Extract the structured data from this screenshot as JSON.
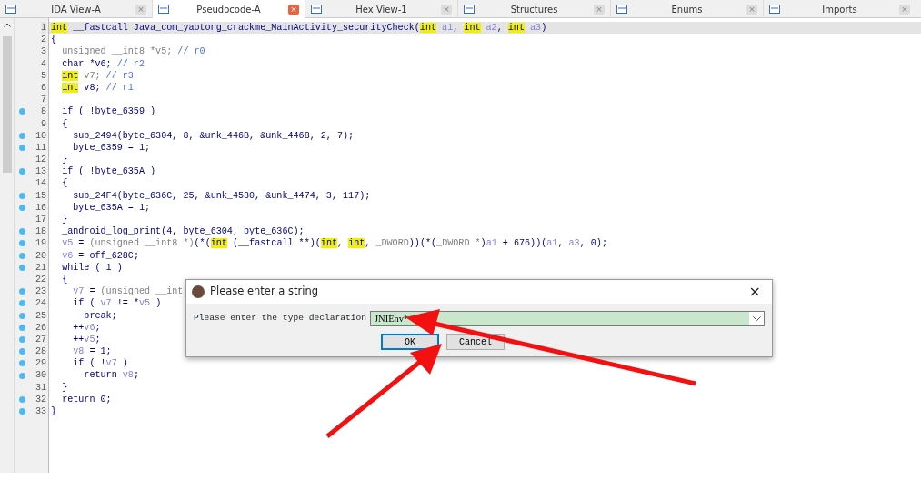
{
  "tabs": [
    {
      "label": "IDA View-A",
      "close": "×",
      "selected": false
    },
    {
      "label": "Pseudocode-A",
      "close": "×",
      "selected": true
    },
    {
      "label": "Hex View-1",
      "close": "×",
      "selected": false
    },
    {
      "label": "Structures",
      "close": "×",
      "selected": false
    },
    {
      "label": "Enums",
      "close": "×",
      "selected": false
    },
    {
      "label": "Imports",
      "close": "×",
      "selected": false
    }
  ],
  "code": [
    {
      "num": "1",
      "breakpoint": false,
      "current": true,
      "segments": [
        {
          "t": "int",
          "kind": "highlight"
        },
        {
          "t": " __fastcall Java_com_yaotong_crackme_MainActivity_securityCheck(",
          "kind": "normal"
        },
        {
          "t": "int",
          "kind": "highlight"
        },
        {
          "t": " a1",
          "kind": "variable"
        },
        {
          "t": ", ",
          "kind": "normal"
        },
        {
          "t": "int",
          "kind": "highlight"
        },
        {
          "t": " a2",
          "kind": "variable"
        },
        {
          "t": ", ",
          "kind": "normal"
        },
        {
          "t": "int",
          "kind": "highlight"
        },
        {
          "t": " a3",
          "kind": "variable"
        },
        {
          "t": ")",
          "kind": "normal"
        }
      ]
    },
    {
      "num": "2",
      "breakpoint": false,
      "current": false,
      "segments": [
        {
          "t": "{",
          "kind": "normal"
        }
      ]
    },
    {
      "num": "3",
      "breakpoint": false,
      "current": false,
      "segments": [
        {
          "t": "  unsigned __int8 *v5; ",
          "kind": "grey"
        },
        {
          "t": "// r0",
          "kind": "comment"
        }
      ]
    },
    {
      "num": "4",
      "breakpoint": false,
      "current": false,
      "segments": [
        {
          "t": "  char *v6; ",
          "kind": "normal"
        },
        {
          "t": "// r2",
          "kind": "comment"
        }
      ]
    },
    {
      "num": "5",
      "breakpoint": false,
      "current": false,
      "segments": [
        {
          "t": "  int",
          "kind": "highlight"
        },
        {
          "t": " v7; ",
          "kind": "grey"
        },
        {
          "t": "// r3",
          "kind": "comment"
        }
      ]
    },
    {
      "num": "6",
      "breakpoint": false,
      "current": false,
      "segments": [
        {
          "t": "  int",
          "kind": "highlight"
        },
        {
          "t": " v8; ",
          "kind": "normal"
        },
        {
          "t": "// r1",
          "kind": "comment"
        }
      ]
    },
    {
      "num": "7",
      "breakpoint": false,
      "current": false
    },
    {
      "num": "8",
      "breakpoint": true,
      "current": false,
      "segments": [
        {
          "t": "  if ( !byte_6359 )",
          "kind": "normal"
        }
      ]
    },
    {
      "num": "9",
      "breakpoint": false,
      "current": false,
      "segments": [
        {
          "t": "  {",
          "kind": "normal"
        }
      ]
    },
    {
      "num": "10",
      "breakpoint": true,
      "current": false,
      "segments": [
        {
          "t": "    sub_2494(byte_6304, 8, &unk_446B, &unk_4468, 2, 7);",
          "kind": "normal"
        }
      ]
    },
    {
      "num": "11",
      "breakpoint": true,
      "current": false,
      "segments": [
        {
          "t": "    byte_6359 = 1;",
          "kind": "normal"
        }
      ]
    },
    {
      "num": "12",
      "breakpoint": false,
      "current": false,
      "segments": [
        {
          "t": "  }",
          "kind": "normal"
        }
      ]
    },
    {
      "num": "13",
      "breakpoint": true,
      "current": false,
      "segments": [
        {
          "t": "  if ( !byte_635A )",
          "kind": "normal"
        }
      ]
    },
    {
      "num": "14",
      "breakpoint": false,
      "current": false,
      "segments": [
        {
          "t": "  {",
          "kind": "normal"
        }
      ]
    },
    {
      "num": "15",
      "breakpoint": true,
      "current": false,
      "segments": [
        {
          "t": "    sub_24F4(byte_636C, 25, &unk_4530, &unk_4474, 3, 117);",
          "kind": "normal"
        }
      ]
    },
    {
      "num": "16",
      "breakpoint": true,
      "current": false,
      "segments": [
        {
          "t": "    byte_635A = 1;",
          "kind": "normal"
        }
      ]
    },
    {
      "num": "17",
      "breakpoint": false,
      "current": false,
      "segments": [
        {
          "t": "  }",
          "kind": "normal"
        }
      ]
    },
    {
      "num": "18",
      "breakpoint": true,
      "current": false,
      "segments": [
        {
          "t": "  _android_log_print(4, byte_6304, byte_636C);",
          "kind": "normal"
        }
      ]
    },
    {
      "num": "19",
      "breakpoint": true,
      "current": false,
      "segments": [
        {
          "t": "  v5",
          "kind": "variable"
        },
        {
          "t": " = ",
          "kind": "normal"
        },
        {
          "t": "(unsigned __int8 *)",
          "kind": "grey"
        },
        {
          "t": "(*(",
          "kind": "normal"
        },
        {
          "t": "int",
          "kind": "highlight"
        },
        {
          "t": " (__fastcall **)(",
          "kind": "normal"
        },
        {
          "t": "int",
          "kind": "highlight"
        },
        {
          "t": ", ",
          "kind": "normal"
        },
        {
          "t": "int",
          "kind": "highlight"
        },
        {
          "t": ", ",
          "kind": "normal"
        },
        {
          "t": "_DWORD",
          "kind": "grey"
        },
        {
          "t": "))(*(",
          "kind": "normal"
        },
        {
          "t": "_DWORD *",
          "kind": "grey"
        },
        {
          "t": ")",
          "kind": "normal"
        },
        {
          "t": "a1",
          "kind": "variable"
        },
        {
          "t": " + 676))(",
          "kind": "normal"
        },
        {
          "t": "a1",
          "kind": "variable"
        },
        {
          "t": ", ",
          "kind": "normal"
        },
        {
          "t": "a3",
          "kind": "variable"
        },
        {
          "t": ", 0);",
          "kind": "normal"
        }
      ]
    },
    {
      "num": "20",
      "breakpoint": true,
      "current": false,
      "segments": [
        {
          "t": "  v6",
          "kind": "variable"
        },
        {
          "t": " = off_628C;",
          "kind": "normal"
        }
      ]
    },
    {
      "num": "21",
      "breakpoint": true,
      "current": false,
      "segments": [
        {
          "t": "  while ( 1 )",
          "kind": "normal"
        }
      ]
    },
    {
      "num": "22",
      "breakpoint": false,
      "current": false,
      "segments": [
        {
          "t": "  {",
          "kind": "normal"
        }
      ]
    },
    {
      "num": "23",
      "breakpoint": true,
      "current": false,
      "segments": [
        {
          "t": "    v7",
          "kind": "variable"
        },
        {
          "t": " = ",
          "kind": "normal"
        },
        {
          "t": "(unsigned __int",
          "kind": "grey"
        }
      ]
    },
    {
      "num": "24",
      "breakpoint": true,
      "current": false,
      "segments": [
        {
          "t": "    if ( ",
          "kind": "normal"
        },
        {
          "t": "v7",
          "kind": "variable"
        },
        {
          "t": " != *",
          "kind": "normal"
        },
        {
          "t": "v5",
          "kind": "variable"
        },
        {
          "t": " )",
          "kind": "normal"
        }
      ]
    },
    {
      "num": "25",
      "breakpoint": true,
      "current": false,
      "segments": [
        {
          "t": "      break;",
          "kind": "normal"
        }
      ]
    },
    {
      "num": "26",
      "breakpoint": true,
      "current": false,
      "segments": [
        {
          "t": "    ++",
          "kind": "normal"
        },
        {
          "t": "v6",
          "kind": "variable"
        },
        {
          "t": ";",
          "kind": "normal"
        }
      ]
    },
    {
      "num": "27",
      "breakpoint": true,
      "current": false,
      "segments": [
        {
          "t": "    ++",
          "kind": "normal"
        },
        {
          "t": "v5",
          "kind": "variable"
        },
        {
          "t": ";",
          "kind": "normal"
        }
      ]
    },
    {
      "num": "28",
      "breakpoint": true,
      "current": false,
      "segments": [
        {
          "t": "    v8",
          "kind": "variable"
        },
        {
          "t": " = 1;",
          "kind": "normal"
        }
      ]
    },
    {
      "num": "29",
      "breakpoint": true,
      "current": false,
      "segments": [
        {
          "t": "    if ( !",
          "kind": "normal"
        },
        {
          "t": "v7",
          "kind": "variable"
        },
        {
          "t": " )",
          "kind": "normal"
        }
      ]
    },
    {
      "num": "30",
      "breakpoint": true,
      "current": false,
      "segments": [
        {
          "t": "      return ",
          "kind": "normal"
        },
        {
          "t": "v8",
          "kind": "variable"
        },
        {
          "t": ";",
          "kind": "normal"
        }
      ]
    },
    {
      "num": "31",
      "breakpoint": false,
      "current": false,
      "segments": [
        {
          "t": "  }",
          "kind": "normal"
        }
      ]
    },
    {
      "num": "32",
      "breakpoint": true,
      "current": false,
      "segments": [
        {
          "t": "  return 0;",
          "kind": "normal"
        }
      ]
    },
    {
      "num": "33",
      "breakpoint": true,
      "current": false,
      "segments": [
        {
          "t": "}",
          "kind": "normal"
        }
      ]
    }
  ],
  "dialog": {
    "title": "Please enter a string",
    "close": "×",
    "label": "Please enter the type declaration",
    "value": "JNIEnv*",
    "buttons": [
      {
        "label": "OK",
        "focused": true
      },
      {
        "label": "Cancel",
        "focused": false
      }
    ]
  }
}
